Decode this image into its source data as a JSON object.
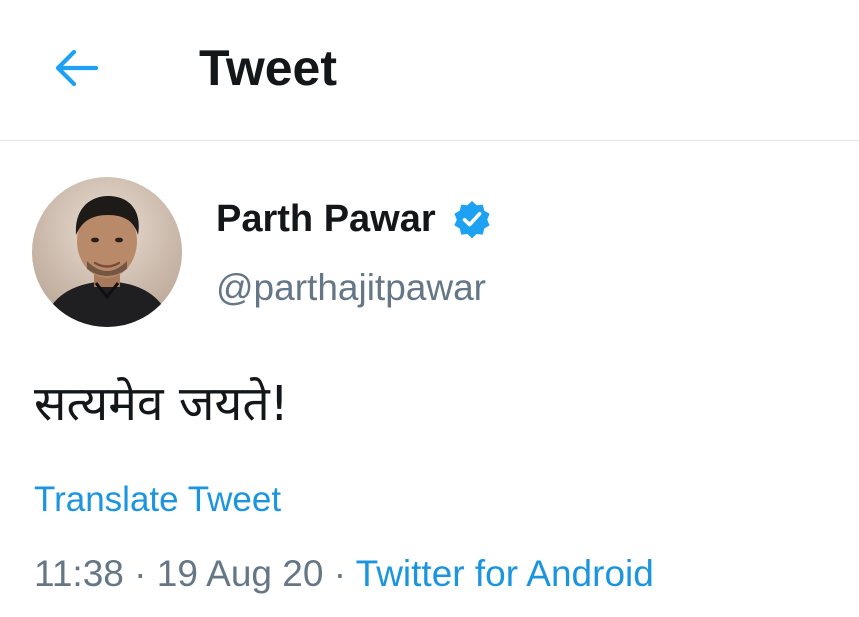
{
  "header": {
    "title": "Tweet",
    "back_icon": "arrow-left-icon"
  },
  "colors": {
    "accent": "#1b95e0",
    "verified": "#1da1f2",
    "secondary_text": "#657786",
    "primary_text": "#14171a",
    "divider": "#e1e8ed"
  },
  "author": {
    "display_name": "Parth Pawar",
    "handle": "@parthajitpawar",
    "verified_icon": "verified-badge-icon",
    "avatar_icon": "avatar-photo"
  },
  "tweet": {
    "text": "सत्यमेव जयते!",
    "translate_label": "Translate Tweet",
    "time": "11:38",
    "separator": " · ",
    "date": "19 Aug 20",
    "source": "Twitter for Android"
  }
}
